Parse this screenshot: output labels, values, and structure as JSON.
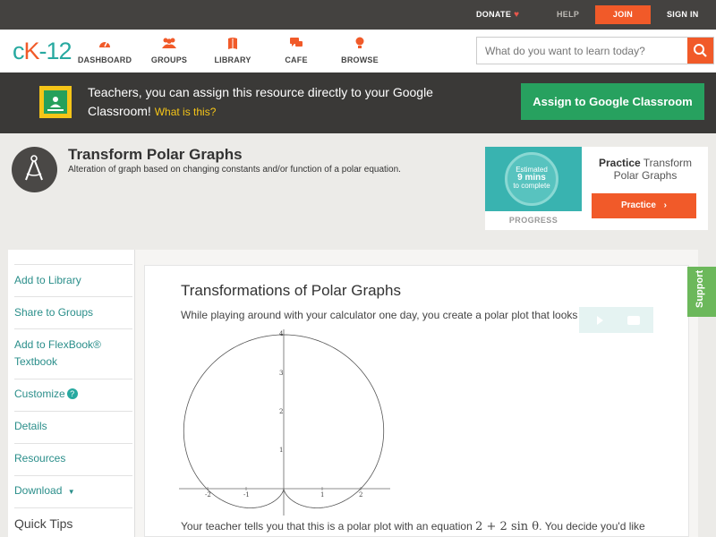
{
  "topbar": {
    "donate": "DONATE",
    "help": "HELP",
    "join": "JOIN",
    "signin": "SIGN IN"
  },
  "logo": {
    "c": "c",
    "k": "K",
    "num": "-12"
  },
  "nav": {
    "items": [
      {
        "label": "DASHBOARD",
        "icon": "dashboard-icon"
      },
      {
        "label": "GROUPS",
        "icon": "groups-icon"
      },
      {
        "label": "LIBRARY",
        "icon": "library-icon"
      },
      {
        "label": "CAFE",
        "icon": "cafe-icon"
      },
      {
        "label": "BROWSE",
        "icon": "browse-icon"
      }
    ],
    "search_placeholder": "What do you want to learn today?"
  },
  "banner": {
    "text": "Teachers, you can assign this resource directly to your Google Classroom!",
    "what_link": "What is this?",
    "assign_button": "Assign to Google Classroom"
  },
  "concept": {
    "title": "Transform Polar Graphs",
    "description": "Alteration of graph based on changing constants and/or function of a polar equation."
  },
  "practice": {
    "estimated_label": "Estimated",
    "minutes": "9 mins",
    "to_complete": "to complete",
    "progress_label": "PROGRESS",
    "title_bold": "Practice",
    "title_rest": "Transform Polar Graphs",
    "button": "Practice"
  },
  "sidebar": {
    "items": [
      {
        "label": "Add to Library"
      },
      {
        "label": "Share to Groups"
      },
      {
        "label": "Add to FlexBook® Textbook"
      },
      {
        "label": "Customize"
      },
      {
        "label": "Details"
      },
      {
        "label": "Resources"
      },
      {
        "label": "Download"
      }
    ],
    "quick_tips": "Quick Tips"
  },
  "content": {
    "heading": "Transformations of Polar Graphs",
    "para1": "While playing around with your calculator one day, you create a polar plot that looks like this",
    "para2_a": "Your teacher tells you that this is a polar plot with an equation",
    "para2_math": "2 + 2 sin θ",
    "para2_b": ". You decide you'd like"
  },
  "graph": {
    "x_ticks": [
      "-2",
      "-1",
      "1",
      "2"
    ],
    "y_ticks": [
      "1",
      "2",
      "3",
      "4"
    ],
    "equation": "r = 2 + 2 sin θ"
  },
  "support": "Support",
  "colors": {
    "brand_orange": "#f15a29",
    "brand_teal": "#27a9a0",
    "classroom_green": "#27a15f"
  }
}
